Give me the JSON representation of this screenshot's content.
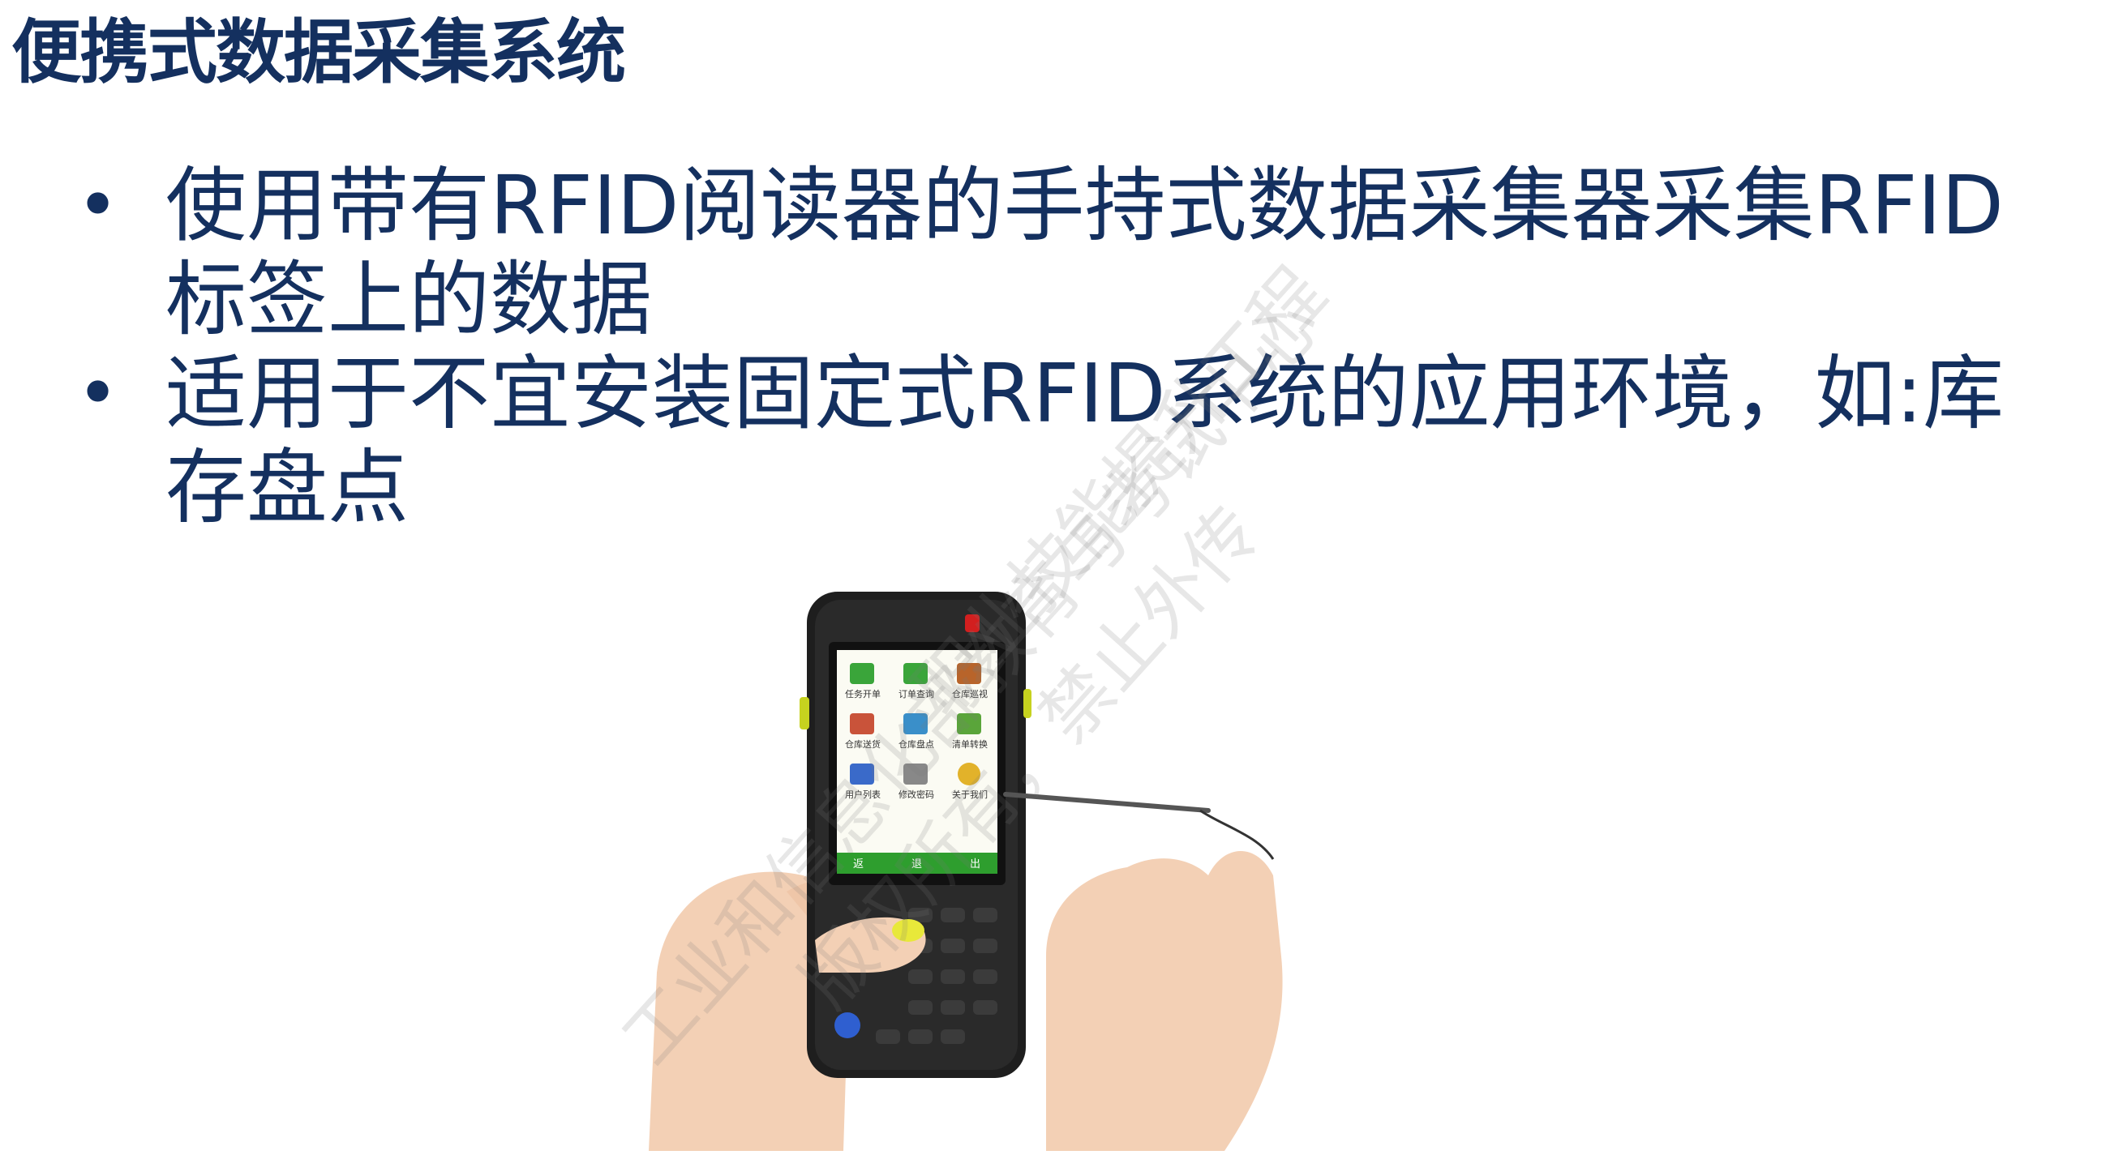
{
  "title": "便携式数据采集系统",
  "bullets": [
    {
      "text": "使用带有RFID阅读器的手持式数据采集器采集RFID标签上的数据"
    },
    {
      "text": "适用于不宜安装固定式RFID系统的应用环境，如:库存盘点"
    }
  ],
  "bullet_symbol": "•",
  "device_screen": {
    "apps": [
      "任务开单",
      "订单查询",
      "仓库巡视",
      "仓库送货",
      "仓库盘点",
      "清单转换",
      "用户列表",
      "修改密码",
      "关于我们"
    ],
    "nav": [
      "返",
      "退",
      "出"
    ]
  },
  "watermark": {
    "line1": "工业和信息化部教育与考试中心",
    "line2": "版权所有，禁止外传",
    "line3": "职业技能提升工程"
  },
  "colors": {
    "text": "#14305f",
    "screen_green": "#2e9e2e"
  }
}
